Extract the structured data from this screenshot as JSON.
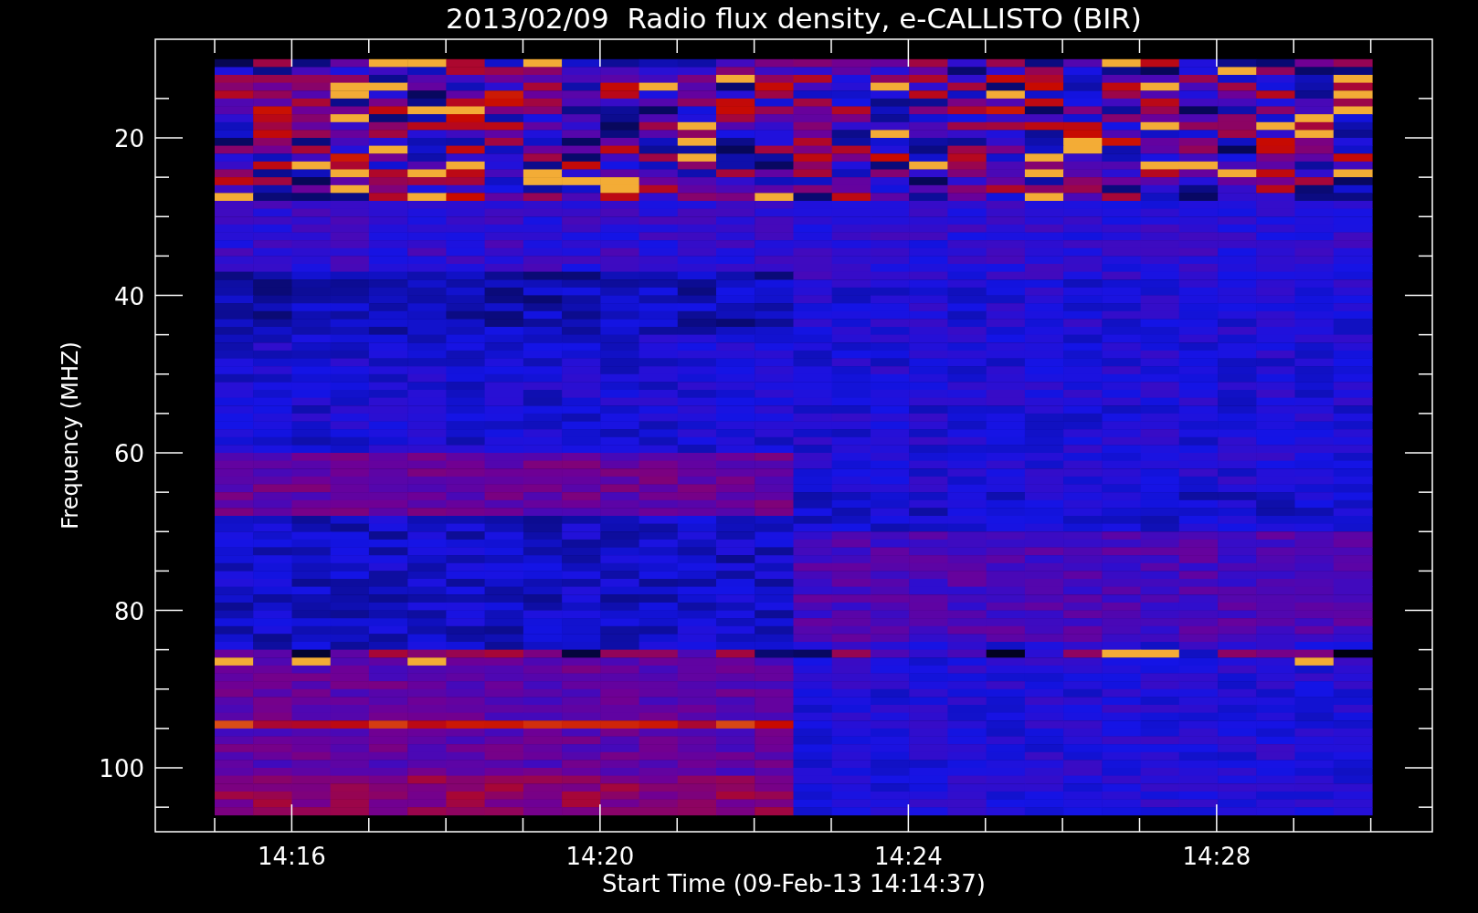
{
  "title": "2013/02/09  Radio flux density, e-CALLISTO (BIR)",
  "xlabel": "Start Time (09-Feb-13 14:14:37)",
  "ylabel": "Frequency (MHZ)",
  "xticks": [
    "14:16",
    "14:20",
    "14:24",
    "14:28"
  ],
  "yticks": [
    "20",
    "40",
    "60",
    "80",
    "100"
  ]
}
